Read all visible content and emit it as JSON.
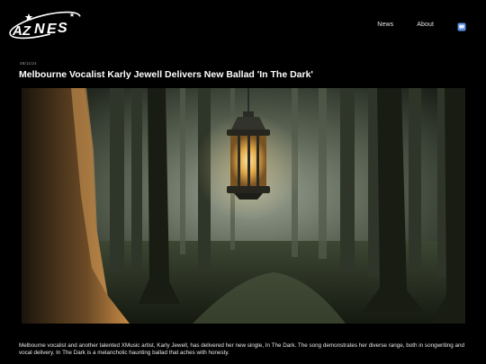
{
  "header": {
    "logo_text": "AZ NEWS",
    "nav": [
      {
        "label": "News"
      },
      {
        "label": "About"
      }
    ],
    "nav_icon": "chat-icon",
    "nav_icon_color": "#8ab4f8"
  },
  "article": {
    "date": "08/11/24",
    "title": "Melbourne Vocalist Karly Jewell Delivers New Ballad 'In The Dark'",
    "hero_image": "foggy-forest-lantern-image",
    "body": "Melbourne vocalist and another talented XMusic artist, Karly Jewell, has delivered her new single, In The Dark. The song demonstrates her diverse range, both in songwriting and vocal delivery. In The Dark is a melancholic haunting ballad that aches with honesty."
  }
}
